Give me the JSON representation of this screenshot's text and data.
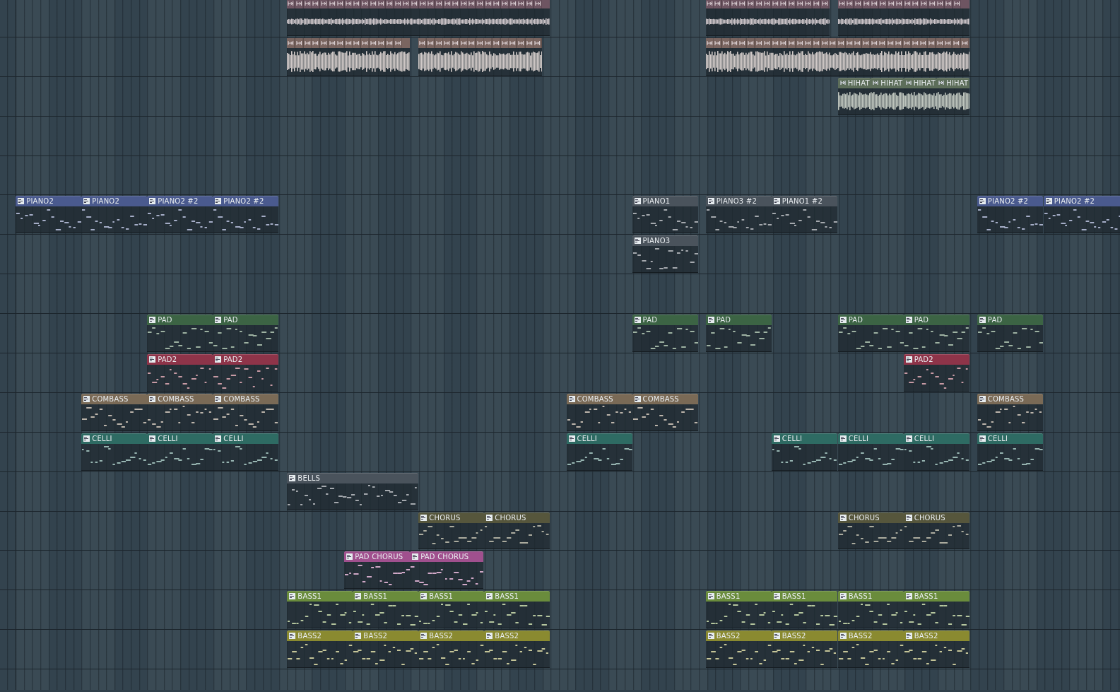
{
  "tracks": [
    {
      "clips": [
        {
          "kind": "slices",
          "color": "#6e5562"
        },
        {
          "kind": "slices",
          "color": "#6e5562"
        },
        {
          "kind": "slices",
          "color": "#6e5562"
        }
      ]
    },
    {
      "clips": [
        {
          "kind": "slices",
          "color": "#7a6560"
        },
        {
          "kind": "slices",
          "color": "#7a6560"
        },
        {
          "kind": "slices",
          "color": "#7a6560"
        }
      ]
    },
    {
      "clips": [
        {
          "kind": "audio",
          "name": "HIHAT",
          "color": "#5d6e5a"
        },
        {
          "kind": "audio",
          "name": "HIHAT",
          "color": "#5d6e5a"
        },
        {
          "kind": "audio",
          "name": "HIHAT",
          "color": "#5d6e5a"
        },
        {
          "kind": "audio",
          "name": "HIHAT",
          "color": "#5d6e5a"
        }
      ]
    },
    {
      "clips": [
        {
          "kind": "pattern",
          "name": "PIANO2",
          "color": "#4a5a8e"
        },
        {
          "kind": "pattern",
          "name": "PIANO2",
          "color": "#4a5a8e"
        },
        {
          "kind": "pattern",
          "name": "PIANO2 #2",
          "color": "#4a5a8e"
        },
        {
          "kind": "pattern",
          "name": "PIANO2 #2",
          "color": "#4a5a8e"
        },
        {
          "kind": "pattern",
          "name": "PIANO1",
          "color": "#4a535c"
        },
        {
          "kind": "pattern",
          "name": "PIANO3 #2",
          "color": "#4a535c"
        },
        {
          "kind": "pattern",
          "name": "PIANO1 #2",
          "color": "#4a535c"
        },
        {
          "kind": "pattern",
          "name": "PIANO2 #2",
          "color": "#4a5a8e"
        },
        {
          "kind": "pattern",
          "name": "PIANO2 #2",
          "color": "#4a5a8e"
        }
      ]
    },
    {
      "clips": [
        {
          "kind": "pattern",
          "name": "PIANO3",
          "color": "#4a535c"
        }
      ]
    },
    {
      "clips": [
        {
          "kind": "pattern",
          "name": "PAD",
          "color": "#3c6444"
        },
        {
          "kind": "pattern",
          "name": "PAD",
          "color": "#3c6444"
        },
        {
          "kind": "pattern",
          "name": "PAD",
          "color": "#3c6444"
        },
        {
          "kind": "pattern",
          "name": "PAD",
          "color": "#3c6444"
        },
        {
          "kind": "pattern",
          "name": "PAD",
          "color": "#3c6444"
        },
        {
          "kind": "pattern",
          "name": "PAD",
          "color": "#3c6444"
        },
        {
          "kind": "pattern",
          "name": "PAD",
          "color": "#3c6444"
        }
      ]
    },
    {
      "clips": [
        {
          "kind": "pattern",
          "name": "PAD2",
          "color": "#8e3449"
        },
        {
          "kind": "pattern",
          "name": "PAD2",
          "color": "#8e3449"
        },
        {
          "kind": "pattern",
          "name": "PAD2",
          "color": "#8e3449"
        }
      ]
    },
    {
      "clips": [
        {
          "kind": "pattern",
          "name": "COMBASS",
          "color": "#7a6a56"
        },
        {
          "kind": "pattern",
          "name": "COMBASS",
          "color": "#7a6a56"
        },
        {
          "kind": "pattern",
          "name": "COMBASS",
          "color": "#7a6a56"
        },
        {
          "kind": "pattern",
          "name": "COMBASS",
          "color": "#7a6a56"
        },
        {
          "kind": "pattern",
          "name": "COMBASS",
          "color": "#7a6a56"
        },
        {
          "kind": "pattern",
          "name": "COMBASS",
          "color": "#7a6a56"
        }
      ]
    },
    {
      "clips": [
        {
          "kind": "pattern",
          "name": "CELLI",
          "color": "#2e6b63"
        },
        {
          "kind": "pattern",
          "name": "CELLI",
          "color": "#2e6b63"
        },
        {
          "kind": "pattern",
          "name": "CELLI",
          "color": "#2e6b63"
        },
        {
          "kind": "pattern",
          "name": "CELLI",
          "color": "#2e6b63"
        },
        {
          "kind": "pattern",
          "name": "CELLI",
          "color": "#2e6b63"
        },
        {
          "kind": "pattern",
          "name": "CELLI",
          "color": "#2e6b63"
        },
        {
          "kind": "pattern",
          "name": "CELLI",
          "color": "#2e6b63"
        },
        {
          "kind": "pattern",
          "name": "CELLI",
          "color": "#2e6b63"
        }
      ]
    },
    {
      "clips": [
        {
          "kind": "pattern",
          "name": "BELLS",
          "color": "#4a535c"
        }
      ]
    },
    {
      "clips": [
        {
          "kind": "pattern",
          "name": "CHORUS",
          "color": "#56563c"
        },
        {
          "kind": "pattern",
          "name": "CHORUS",
          "color": "#56563c"
        },
        {
          "kind": "pattern",
          "name": "CHORUS",
          "color": "#56563c"
        },
        {
          "kind": "pattern",
          "name": "CHORUS",
          "color": "#56563c"
        }
      ]
    },
    {
      "clips": [
        {
          "kind": "pattern",
          "name": "PAD CHORUS",
          "color": "#a0508e"
        },
        {
          "kind": "pattern",
          "name": "PAD CHORUS",
          "color": "#a0508e"
        }
      ]
    },
    {
      "clips": [
        {
          "kind": "pattern",
          "name": "BASS1",
          "color": "#6a8c3c"
        },
        {
          "kind": "pattern",
          "name": "BASS1",
          "color": "#6a8c3c"
        },
        {
          "kind": "pattern",
          "name": "BASS1",
          "color": "#6a8c3c"
        },
        {
          "kind": "pattern",
          "name": "BASS1",
          "color": "#6a8c3c"
        },
        {
          "kind": "pattern",
          "name": "BASS1",
          "color": "#6a8c3c"
        },
        {
          "kind": "pattern",
          "name": "BASS1",
          "color": "#6a8c3c"
        },
        {
          "kind": "pattern",
          "name": "BASS1",
          "color": "#6a8c3c"
        },
        {
          "kind": "pattern",
          "name": "BASS1",
          "color": "#6a8c3c"
        }
      ]
    },
    {
      "clips": [
        {
          "kind": "pattern",
          "name": "BASS2",
          "color": "#8a8a30"
        },
        {
          "kind": "pattern",
          "name": "BASS2",
          "color": "#8a8a30"
        },
        {
          "kind": "pattern",
          "name": "BASS2",
          "color": "#8a8a30"
        },
        {
          "kind": "pattern",
          "name": "BASS2",
          "color": "#8a8a30"
        },
        {
          "kind": "pattern",
          "name": "BASS2",
          "color": "#8a8a30"
        },
        {
          "kind": "pattern",
          "name": "BASS2",
          "color": "#8a8a30"
        },
        {
          "kind": "pattern",
          "name": "BASS2",
          "color": "#8a8a30"
        },
        {
          "kind": "pattern",
          "name": "BASS2",
          "color": "#8a8a30"
        }
      ]
    }
  ]
}
